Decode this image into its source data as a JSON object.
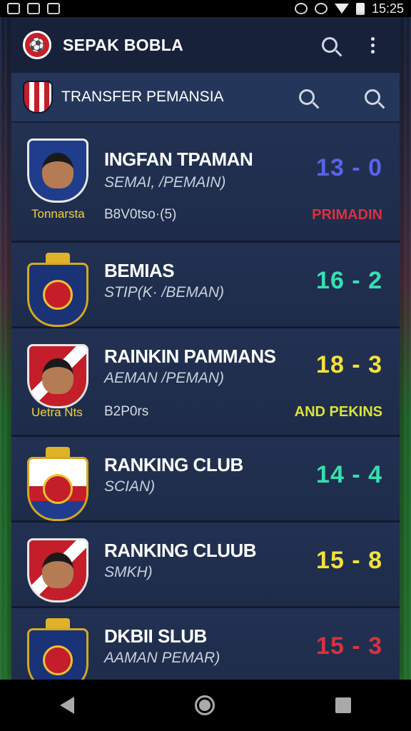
{
  "status_bar": {
    "time": "15:25"
  },
  "appbar": {
    "title": "SEPAK BOBLA"
  },
  "subbar": {
    "title": "TRANSFER PEMANSIA"
  },
  "rows": [
    {
      "name": "INGFAN TPAMAN",
      "sub": "SEMAI, /PEMAIN)",
      "score": "13 - 0",
      "score_color": "#5a63e8",
      "left_label": "Tonnarsta",
      "meta": "B8V0tso·(5)",
      "tag": "PRIMADIN",
      "tag_color": "#d8323f"
    },
    {
      "name": "BEMIAS",
      "sub": "STIP(K· /BEMAN)",
      "score": "16 - 2",
      "score_color": "#36e0b0"
    },
    {
      "name": "RAINKIN PAMMANS",
      "sub": "AEMAN /PEMAN)",
      "score": "18 - 3",
      "score_color": "#f2e23a",
      "left_label": "Uetra Nts",
      "meta": "B2P0rs",
      "tag": "AND PEKINS",
      "tag_color": "#d9e23a"
    },
    {
      "name": "RANKING CLUB",
      "sub": "SCIAN)",
      "score": "14 - 4",
      "score_color": "#36e0b0"
    },
    {
      "name": "RANKING CLUUB",
      "sub": "SMKH)",
      "score": "15 - 8",
      "score_color": "#f2e23a"
    },
    {
      "name": "DKBII SLUB",
      "sub": "AAMAN PEMAR)",
      "score": "15 - 3",
      "score_color": "#d8323f"
    }
  ]
}
